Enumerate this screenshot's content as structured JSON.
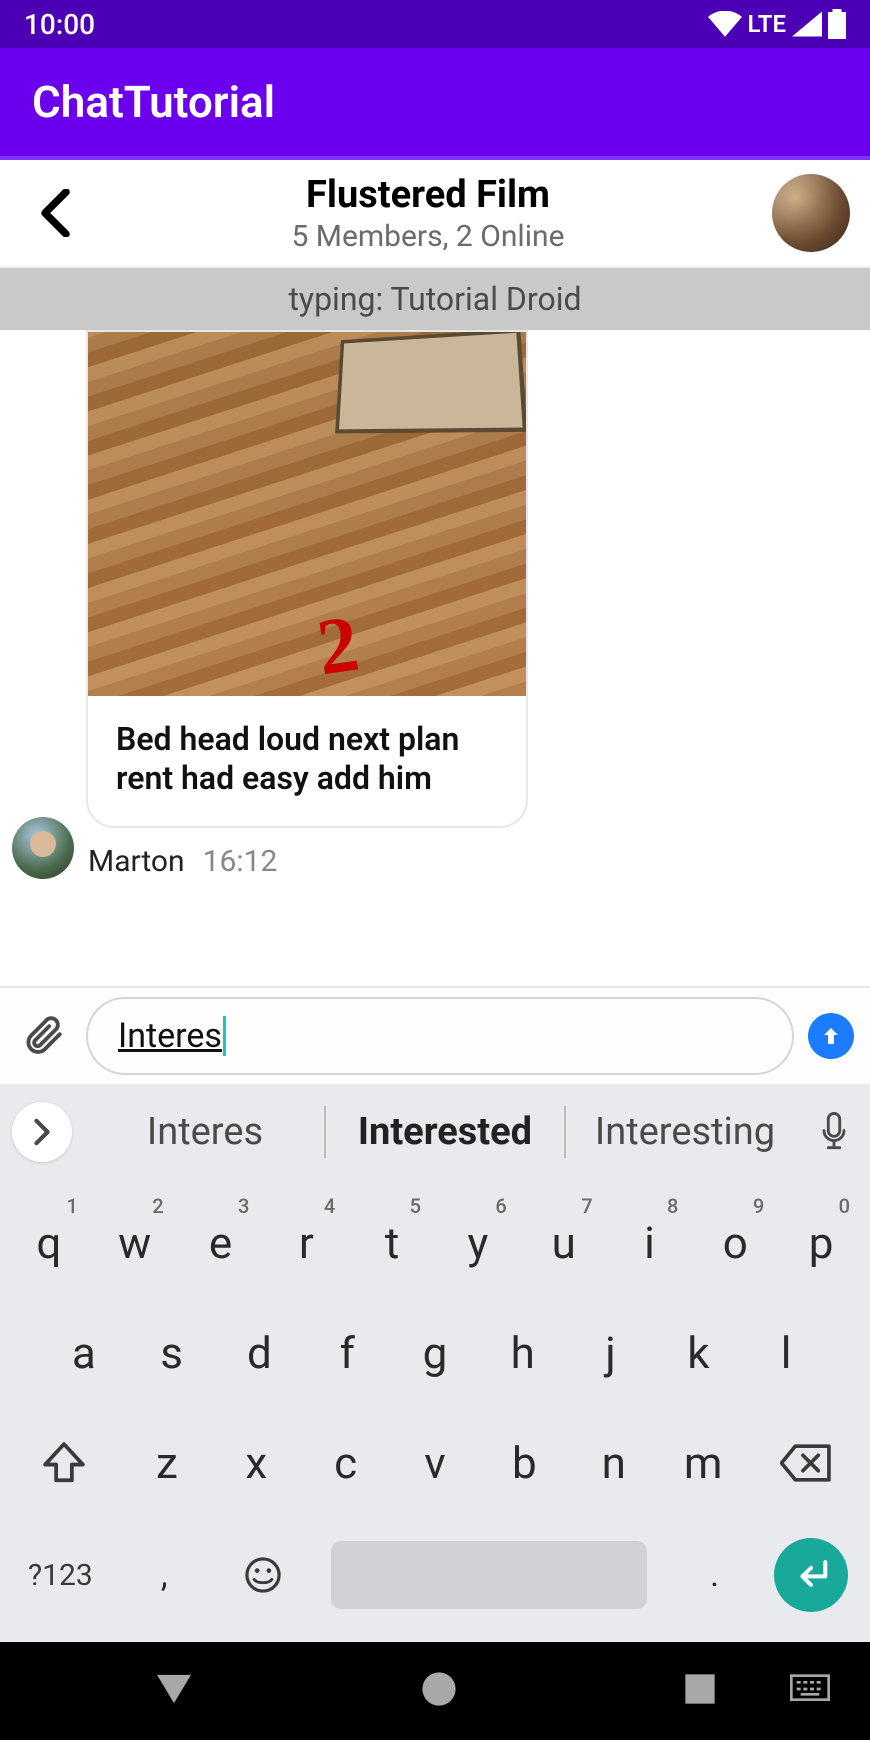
{
  "status": {
    "time": "10:00",
    "network": "LTE"
  },
  "appbar": {
    "title": "ChatTutorial"
  },
  "chat": {
    "title": "Flustered Film",
    "subtitle": "5 Members, 2 Online",
    "typing_label": "typing: Tutorial Droid"
  },
  "message": {
    "text": "Bed head loud next plan rent had easy add him",
    "sender": "Marton",
    "time": "16:12"
  },
  "input": {
    "value": "Interes"
  },
  "suggestions": [
    "Interes",
    "Interested",
    "Interesting"
  ],
  "keys": {
    "row1": [
      {
        "k": "q",
        "n": "1"
      },
      {
        "k": "w",
        "n": "2"
      },
      {
        "k": "e",
        "n": "3"
      },
      {
        "k": "r",
        "n": "4"
      },
      {
        "k": "t",
        "n": "5"
      },
      {
        "k": "y",
        "n": "6"
      },
      {
        "k": "u",
        "n": "7"
      },
      {
        "k": "i",
        "n": "8"
      },
      {
        "k": "o",
        "n": "9"
      },
      {
        "k": "p",
        "n": "0"
      }
    ],
    "row2": [
      "a",
      "s",
      "d",
      "f",
      "g",
      "h",
      "j",
      "k",
      "l"
    ],
    "row3": [
      "z",
      "x",
      "c",
      "v",
      "b",
      "n",
      "m"
    ],
    "sym": "?123",
    "comma": ",",
    "period": "."
  }
}
